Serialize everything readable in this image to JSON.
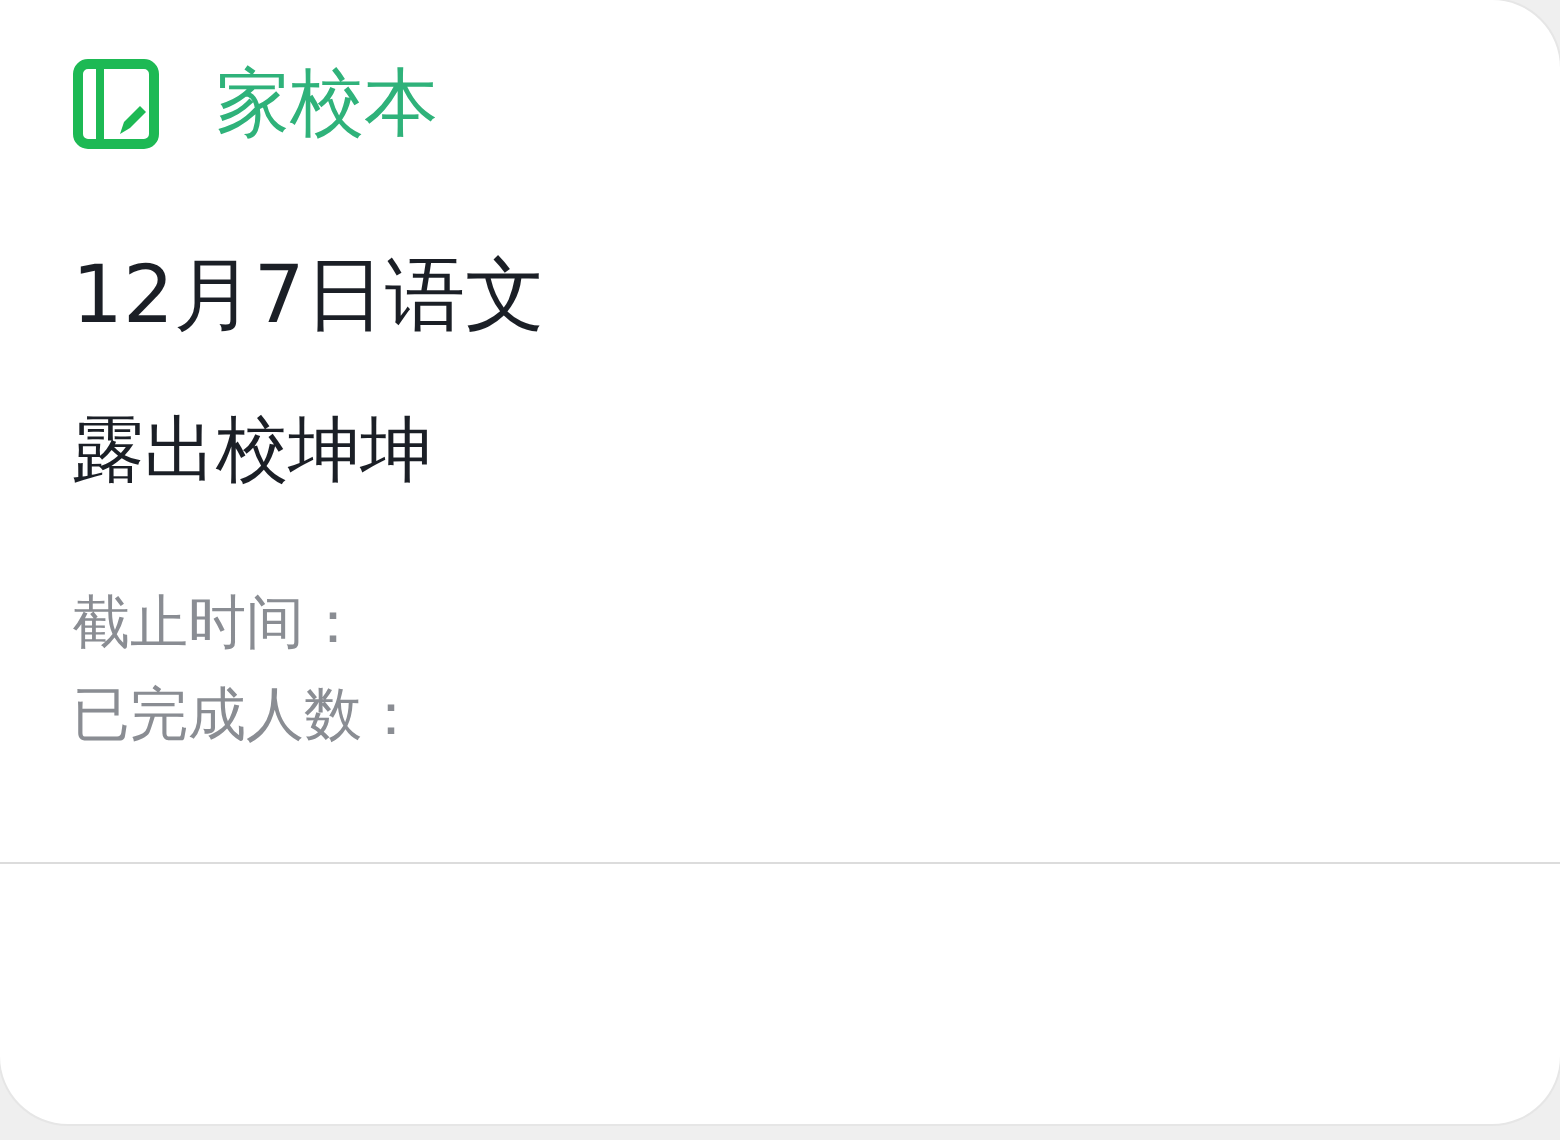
{
  "app": {
    "name": "家校本"
  },
  "card": {
    "title": "12月7日语文",
    "content": "露出校坤坤",
    "fields": [
      {
        "label": "截止时间："
      },
      {
        "label": "已完成人数："
      }
    ]
  }
}
